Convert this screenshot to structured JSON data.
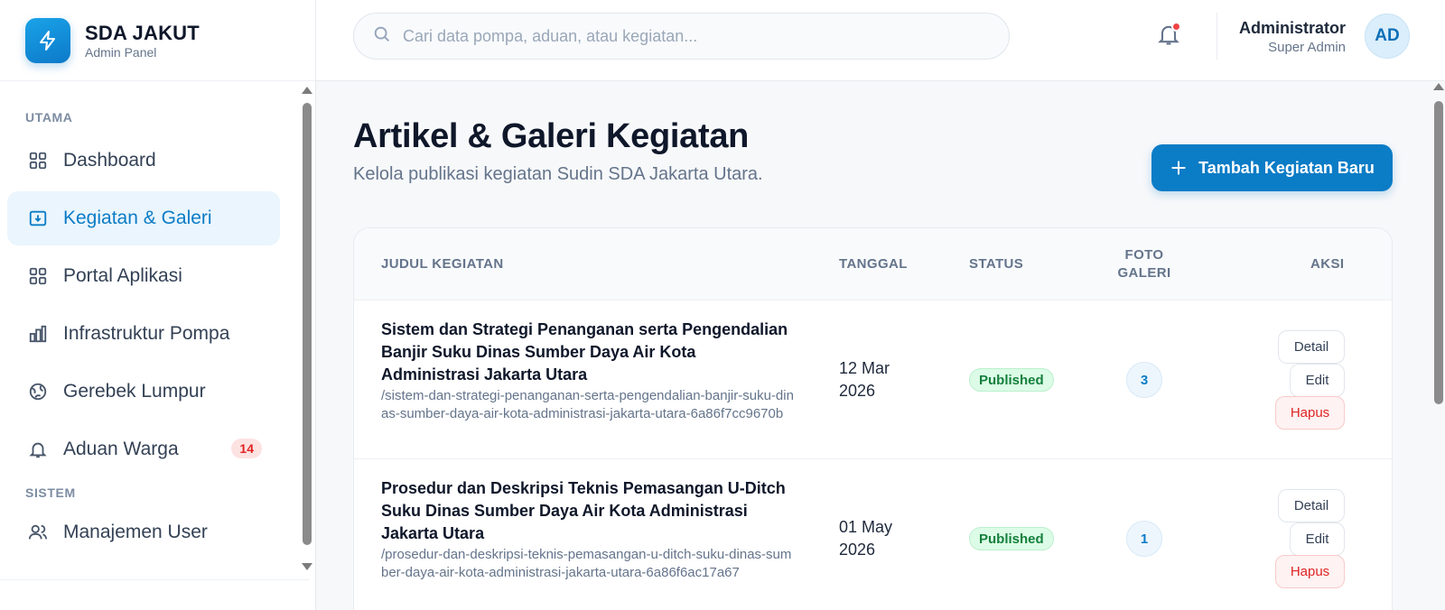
{
  "brand": {
    "title": "SDA JAKUT",
    "subtitle": "Admin Panel"
  },
  "sidebar": {
    "sections": [
      {
        "label": "UTAMA"
      },
      {
        "label": "SISTEM"
      }
    ],
    "items": [
      {
        "label": "Dashboard",
        "icon": "grid-icon"
      },
      {
        "label": "Kegiatan & Galeri",
        "icon": "gallery-icon",
        "active": true
      },
      {
        "label": "Portal Aplikasi",
        "icon": "grid-icon"
      },
      {
        "label": "Infrastruktur Pompa",
        "icon": "bar-chart-icon"
      },
      {
        "label": "Gerebek Lumpur",
        "icon": "globe-icon"
      },
      {
        "label": "Aduan Warga",
        "icon": "bell-icon",
        "badge": "14"
      },
      {
        "label": "Manajemen User",
        "icon": "users-icon"
      }
    ]
  },
  "topbar": {
    "search_placeholder": "Cari data pompa, aduan, atau kegiatan...",
    "user_name": "Administrator",
    "user_role": "Super Admin",
    "avatar_initials": "AD"
  },
  "page": {
    "title": "Artikel & Galeri Kegiatan",
    "subtitle": "Kelola publikasi kegiatan Sudin SDA Jakarta Utara.",
    "add_button": "Tambah Kegiatan Baru"
  },
  "table": {
    "columns": {
      "title": "JUDUL KEGIATAN",
      "date": "TANGGAL",
      "status": "STATUS",
      "photos_line1": "FOTO",
      "photos_line2": "GALERI",
      "actions": "AKSI"
    },
    "actions": {
      "detail": "Detail",
      "edit": "Edit",
      "delete": "Hapus"
    },
    "rows": [
      {
        "title": "Sistem dan Strategi Penanganan serta Pengendalian Banjir Suku Dinas Sumber Daya Air Kota Administrasi Jakarta Utara",
        "slug": "/sistem-dan-strategi-penanganan-serta-pengendalian-banjir-suku-dinas-sumber-daya-air-kota-administrasi-jakarta-utara-6a86f7cc9670b",
        "date_line1": "12 Mar",
        "date_line2": "2026",
        "status": "Published",
        "photos": "3"
      },
      {
        "title": "Prosedur dan Deskripsi Teknis Pemasangan U-Ditch Suku Dinas Sumber Daya Air Kota Administrasi Jakarta Utara",
        "slug": "/prosedur-dan-deskripsi-teknis-pemasangan-u-ditch-suku-dinas-sumber-daya-air-kota-administrasi-jakarta-utara-6a86f6ac17a67",
        "date_line1": "01 May",
        "date_line2": "2026",
        "status": "Published",
        "photos": "1"
      }
    ]
  },
  "colors": {
    "accent": "#0b7cc6",
    "active_bg": "#eaf5fd",
    "published_bg": "#dcfce7",
    "published_text": "#15803d",
    "danger": "#e02424"
  }
}
